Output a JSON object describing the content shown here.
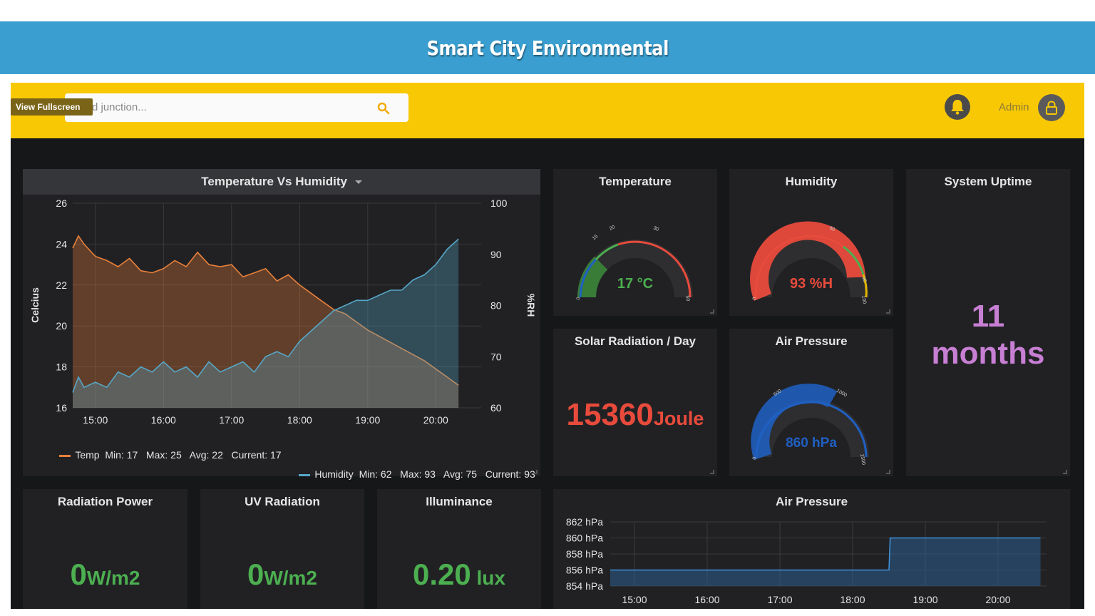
{
  "app": {
    "title": "Smart City Environmental"
  },
  "toolbar": {
    "fullscreen_label": "View Fullscreen",
    "search_placeholder": "d junction...",
    "admin_label": "Admin"
  },
  "colors": {
    "temp": "#e8803a",
    "humidity": "#57a7c7",
    "green": "#4caf50",
    "red": "#e84b3c",
    "purple": "#c77fd3",
    "blue": "#1f60c4"
  },
  "panels": {
    "temp_humidity": {
      "title": "Temperature Vs Humidity",
      "legend_temp": "Temp  Min: 17   Max: 25   Avg: 22   Current: 17",
      "legend_humidity": "Humidity  Min: 62   Max: 93   Avg: 75   Current: 93"
    },
    "temperature": {
      "title": "Temperature",
      "value": "17 °C"
    },
    "humidity": {
      "title": "Humidity",
      "value": "93 %H"
    },
    "uptime": {
      "title": "System Uptime",
      "value": "11",
      "unit": "months"
    },
    "solar": {
      "title": "Solar Radiation / Day",
      "value": "15360",
      "unit": "Joule"
    },
    "air_pressure_gauge": {
      "title": "Air Pressure",
      "value": "860 hPa"
    },
    "radiation_power": {
      "title": "Radiation Power",
      "value": "0",
      "unit": "W/m2"
    },
    "uv": {
      "title": "UV Radiation",
      "value": "0",
      "unit": "W/m2"
    },
    "illuminance": {
      "title": "Illuminance",
      "value": "0.20",
      "unit": "lux"
    },
    "air_pressure_chart": {
      "title": "Air Pressure"
    }
  },
  "chart_data": [
    {
      "type": "line",
      "title": "Temperature Vs Humidity",
      "ylabel": "Celcius",
      "ylabel_right": "%RH",
      "x_ticks": [
        "15:00",
        "16:00",
        "17:00",
        "18:00",
        "19:00",
        "20:00"
      ],
      "ylim": [
        16,
        26
      ],
      "ylim_right": [
        60,
        100
      ],
      "y_ticks": [
        "16",
        "18",
        "20",
        "22",
        "24",
        "26"
      ],
      "y_ticks_right": [
        "60",
        "70",
        "80",
        "90",
        "100"
      ],
      "series": [
        {
          "name": "Temp",
          "axis": "left",
          "x": [
            "14:40",
            "14:45",
            "14:50",
            "15:00",
            "15:10",
            "15:20",
            "15:30",
            "15:40",
            "15:50",
            "16:00",
            "16:10",
            "16:20",
            "16:30",
            "16:40",
            "16:50",
            "17:00",
            "17:10",
            "17:20",
            "17:30",
            "17:40",
            "17:50",
            "18:00",
            "18:10",
            "18:20",
            "18:30",
            "18:40",
            "18:50",
            "19:00",
            "19:10",
            "19:20",
            "19:30",
            "19:40",
            "19:50",
            "20:00",
            "20:10",
            "20:20"
          ],
          "values": [
            23.8,
            24.4,
            24.0,
            23.4,
            23.2,
            22.9,
            23.3,
            22.7,
            22.6,
            22.8,
            23.2,
            22.9,
            23.6,
            23.0,
            22.9,
            23.0,
            22.4,
            22.6,
            22.8,
            22.2,
            22.5,
            22.0,
            21.6,
            21.2,
            20.8,
            20.6,
            20.2,
            19.8,
            19.5,
            19.2,
            18.9,
            18.6,
            18.3,
            17.9,
            17.5,
            17.1
          ]
        },
        {
          "name": "Humidity",
          "axis": "right",
          "x": [
            "14:40",
            "14:45",
            "14:50",
            "15:00",
            "15:10",
            "15:20",
            "15:30",
            "15:40",
            "15:50",
            "16:00",
            "16:10",
            "16:20",
            "16:30",
            "16:40",
            "16:50",
            "17:00",
            "17:10",
            "17:20",
            "17:30",
            "17:40",
            "17:50",
            "18:00",
            "18:10",
            "18:20",
            "18:30",
            "18:40",
            "18:50",
            "19:00",
            "19:10",
            "19:20",
            "19:30",
            "19:40",
            "19:50",
            "20:00",
            "20:10",
            "20:20"
          ],
          "values": [
            63,
            66,
            64,
            65,
            64,
            67,
            66,
            68,
            67,
            69,
            67,
            68,
            66,
            69,
            67,
            68,
            69,
            67,
            70,
            71,
            70,
            73,
            75,
            77,
            79,
            80,
            81,
            81,
            82,
            83,
            83,
            85,
            86,
            88,
            91,
            93
          ]
        }
      ]
    },
    {
      "type": "area",
      "title": "Air Pressure",
      "x_ticks": [
        "15:00",
        "16:00",
        "17:00",
        "18:00",
        "19:00",
        "20:00"
      ],
      "y_ticks": [
        "854 hPa",
        "856 hPa",
        "858 hPa",
        "860 hPa",
        "862 hPa"
      ],
      "ylim": [
        854,
        862
      ],
      "series": [
        {
          "name": "Air Pressure",
          "x": [
            "14:40",
            "18:30",
            "18:31",
            "20:35"
          ],
          "values": [
            856,
            856,
            860,
            860
          ]
        }
      ]
    }
  ]
}
